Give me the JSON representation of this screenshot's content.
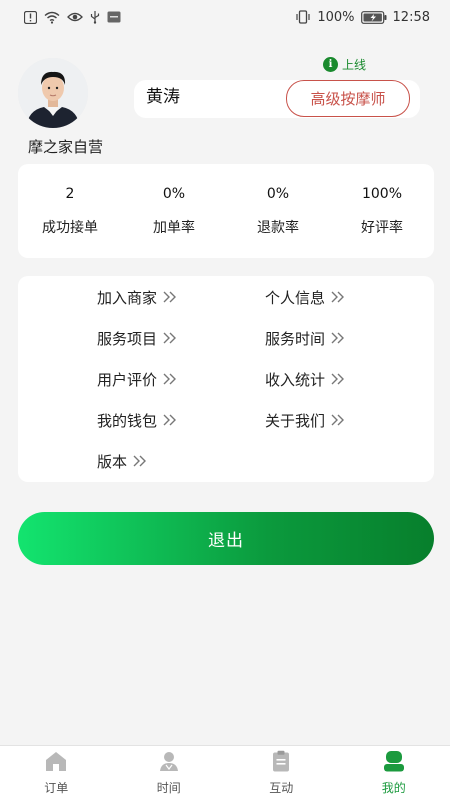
{
  "status_bar": {
    "battery": "100%",
    "time": "12:58"
  },
  "profile": {
    "name": "黄涛",
    "level": "高级按摩师",
    "online_label": "上线",
    "online_badge": "i",
    "store_name": "摩之家自营"
  },
  "stats": [
    {
      "value": "2",
      "label": "成功接单"
    },
    {
      "value": "0%",
      "label": "加单率"
    },
    {
      "value": "0%",
      "label": "退款率"
    },
    {
      "value": "100%",
      "label": "好评率"
    }
  ],
  "menu": [
    {
      "label": "加入商家"
    },
    {
      "label": "个人信息"
    },
    {
      "label": "服务项目"
    },
    {
      "label": "服务时间"
    },
    {
      "label": "用户评价"
    },
    {
      "label": "收入统计"
    },
    {
      "label": "我的钱包"
    },
    {
      "label": "关于我们"
    },
    {
      "label": "版本"
    }
  ],
  "logout_label": "退出",
  "tabs": [
    {
      "label": "订单",
      "icon": "home-icon"
    },
    {
      "label": "时间",
      "icon": "person-icon"
    },
    {
      "label": "互动",
      "icon": "clipboard-icon"
    },
    {
      "label": "我的",
      "icon": "profile-icon",
      "active": true
    }
  ],
  "colors": {
    "accent_green": "#1b9a3e",
    "badge_red": "#c8524a",
    "background": "#f4f4f4"
  }
}
